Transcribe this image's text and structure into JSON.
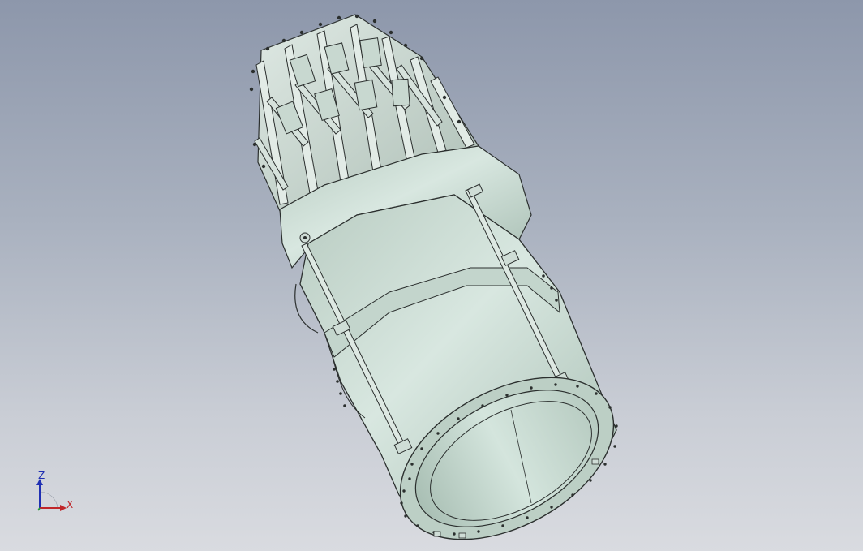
{
  "viewport": {
    "background_top": "#8d97ab",
    "background_bottom": "#d9dbe0",
    "model_color": "#cfe0d8",
    "model_shade": "#9fb4aa",
    "edge_color": "#2b2f2e"
  },
  "triad": {
    "z_label": "Z",
    "x_label": "X",
    "z_color": "#1f2fb3",
    "x_color": "#c0262a",
    "y_color": "#2a9a3a"
  }
}
